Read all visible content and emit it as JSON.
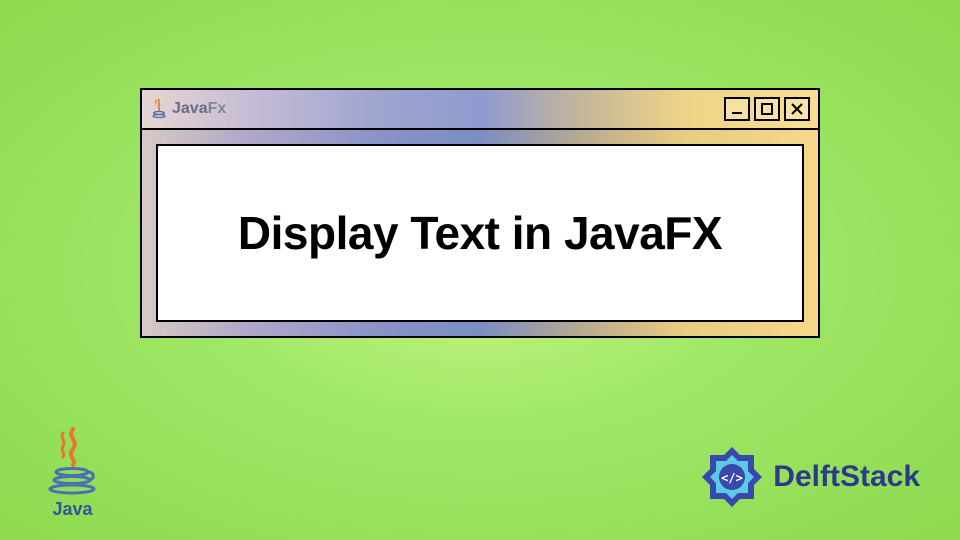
{
  "window": {
    "app_name_main": "Java",
    "app_name_suffix": "Fx",
    "controls": {
      "minimize": "minimize",
      "maximize": "maximize",
      "close": "close"
    }
  },
  "content": {
    "heading": "Display Text in JavaFX"
  },
  "footer": {
    "java_label": "Java",
    "brand_label": "DelftStack"
  }
}
